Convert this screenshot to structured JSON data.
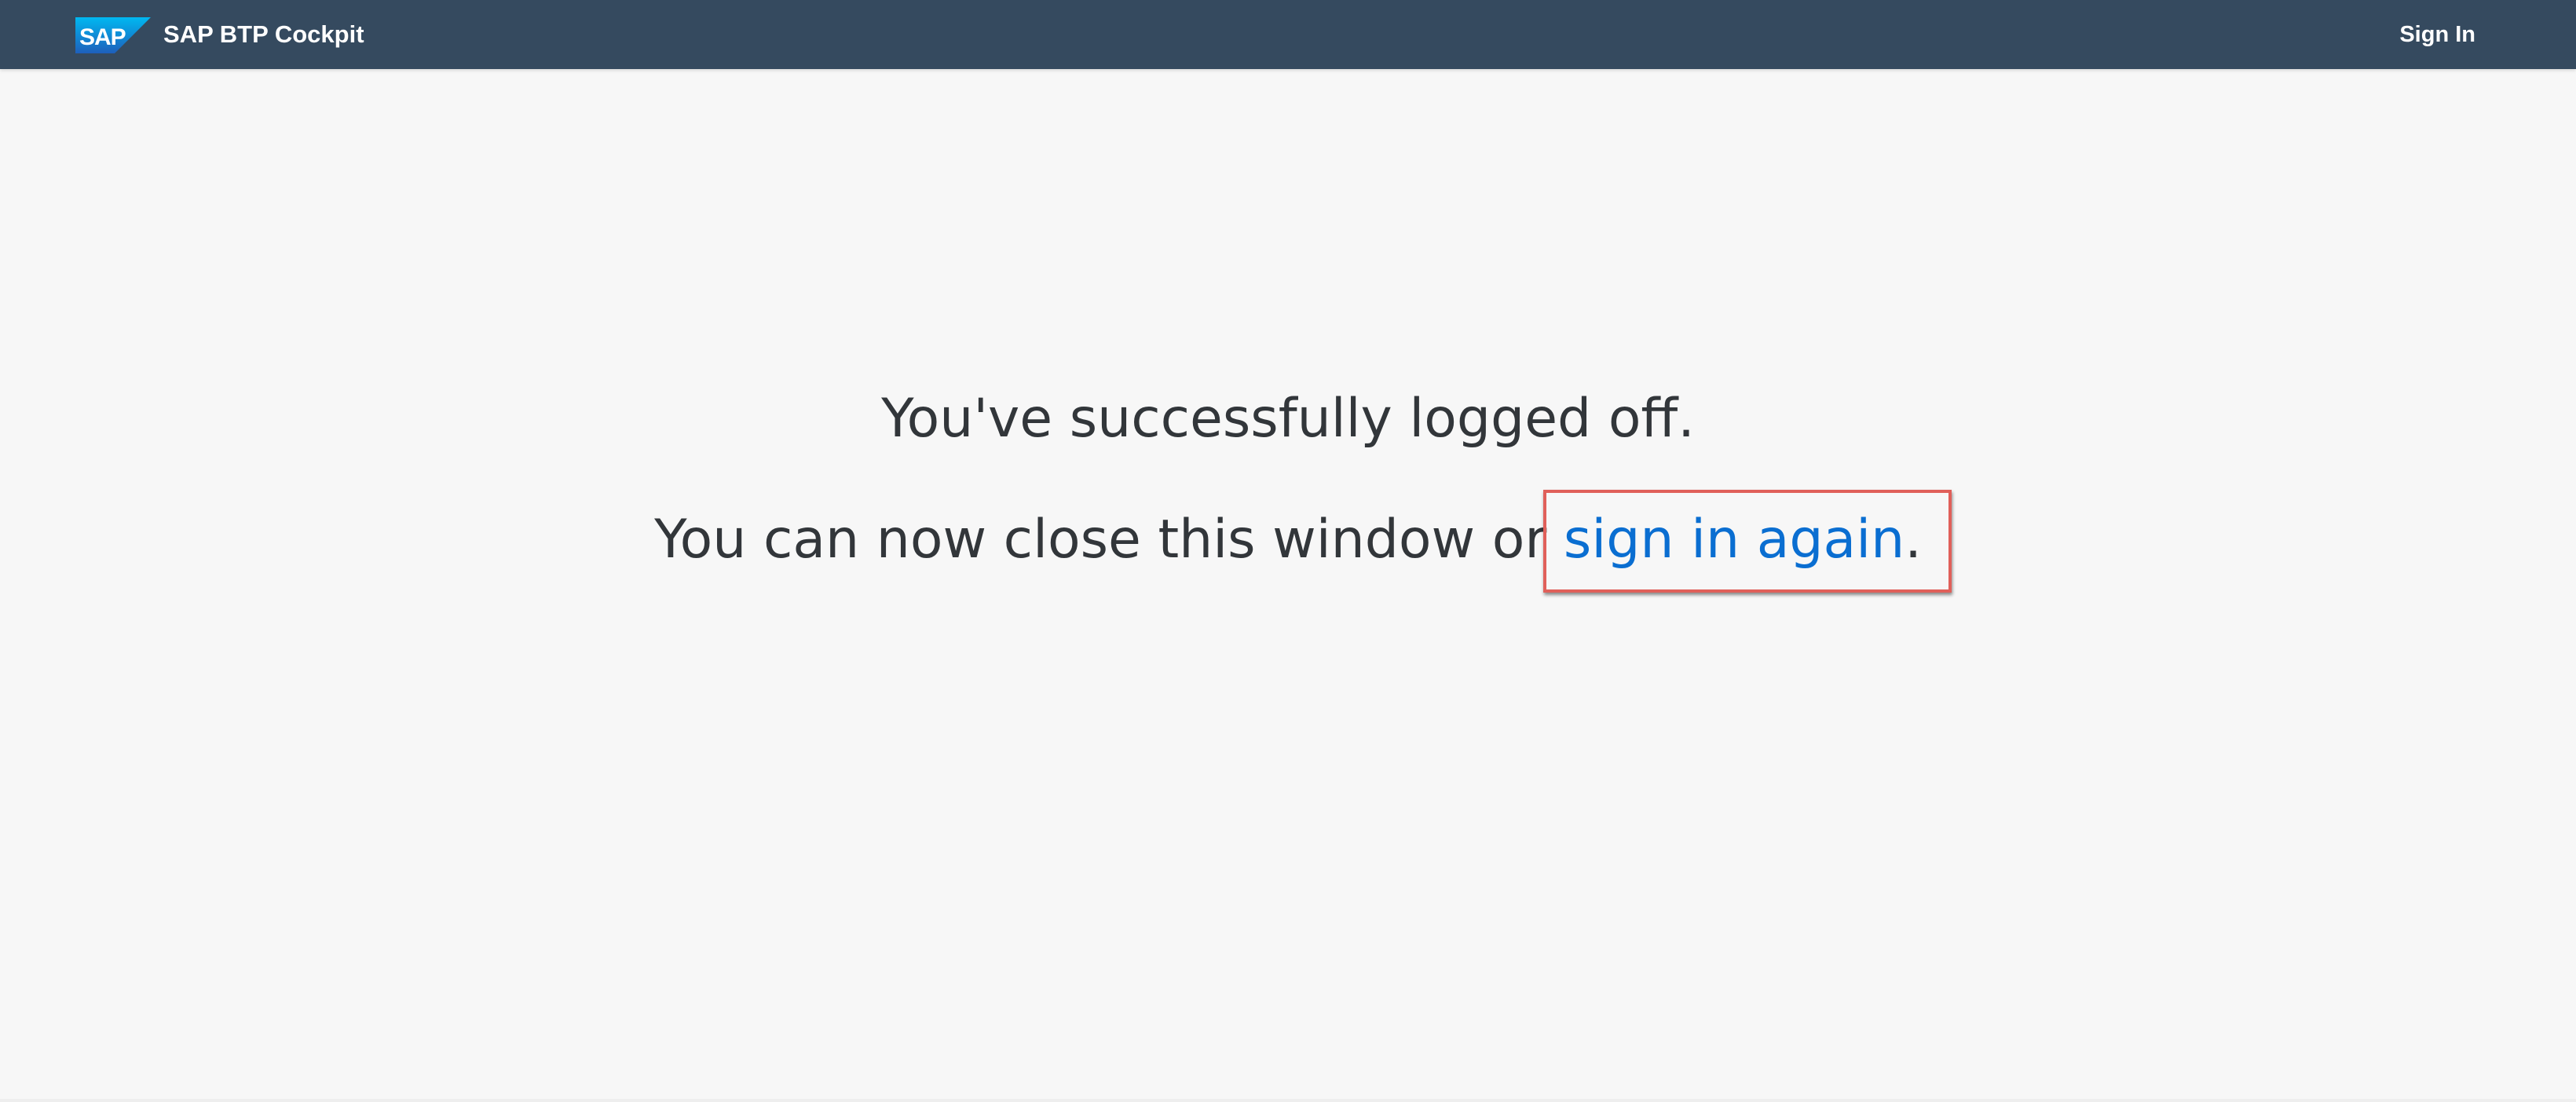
{
  "shell": {
    "logo_text": "SAP",
    "title": "SAP BTP Cockpit",
    "sign_in_label": "Sign In",
    "bar_color": "#354a5f"
  },
  "message": {
    "headline": "You've successfully logged off.",
    "subline_prefix": "You can now close this window or ",
    "sign_in_again_label": "sign in again",
    "subline_suffix": "."
  },
  "colors": {
    "background": "#f7f7f7",
    "text": "#32363a",
    "link": "#0a6ed1",
    "highlight_box": "#e0605a"
  },
  "icons": {
    "logo": "sap-logo"
  }
}
